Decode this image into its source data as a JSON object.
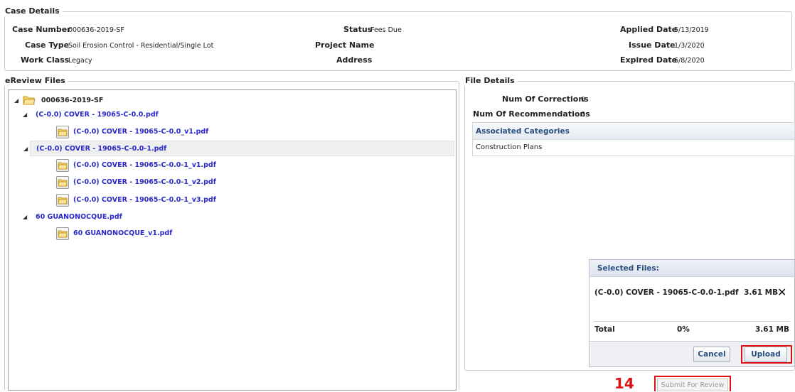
{
  "case_details": {
    "legend": "Case Details",
    "case_number_label": "Case Number",
    "case_number": "000636-2019-SF",
    "case_type_label": "Case Type",
    "case_type": "Soil Erosion Control - Residential/Single Lot",
    "work_class_label": "Work Class",
    "work_class": "Legacy",
    "status_label": "Status",
    "status": "Fees Due",
    "project_name_label": "Project Name",
    "project_name": "",
    "address_label": "Address",
    "address": "",
    "applied_date_label": "Applied Date",
    "applied_date": "5/13/2019",
    "issue_date_label": "Issue Date",
    "issue_date": "1/3/2020",
    "expired_date_label": "Expired Date",
    "expired_date": "6/8/2020"
  },
  "ereview": {
    "legend": "eReview Files",
    "root": "000636-2019-SF",
    "items": [
      {
        "label": "(C-0.0) COVER - 19065-C-0.0.pdf"
      },
      {
        "label": "(C-0.0) COVER - 19065-C-0.0_v1.pdf"
      },
      {
        "label": "(C-0.0) COVER - 19065-C-0.0-1.pdf"
      },
      {
        "label": "(C-0.0) COVER - 19065-C-0.0-1_v1.pdf"
      },
      {
        "label": "(C-0.0) COVER - 19065-C-0.0-1_v2.pdf"
      },
      {
        "label": "(C-0.0) COVER - 19065-C-0.0-1_v3.pdf"
      },
      {
        "label": "60 GUANONOCQUE.pdf"
      },
      {
        "label": "60 GUANONOCQUE_v1.pdf"
      }
    ]
  },
  "file_details": {
    "legend": "File Details",
    "num_corrections_label": "Num Of Corrections",
    "num_corrections": "0",
    "num_recommendations_label": "Num Of Recommendations",
    "num_recommendations": "0",
    "categories_header": "Associated Categories",
    "categories": [
      "Construction Plans"
    ]
  },
  "selected_files": {
    "header": "Selected Files:",
    "file_name": "(C-0.0) COVER - 19065-C-0.0-1.pdf",
    "file_size": "3.61 MB",
    "total_label": "Total",
    "total_percent": "0%",
    "total_size": "3.61 MB",
    "cancel_label": "Cancel",
    "upload_label": "Upload"
  },
  "actions": {
    "submit_label": "Submit For Review",
    "step_number": "14"
  },
  "colors": {
    "highlight": "#e01010",
    "link": "#2a2acc",
    "header_text": "#2a4f80"
  }
}
